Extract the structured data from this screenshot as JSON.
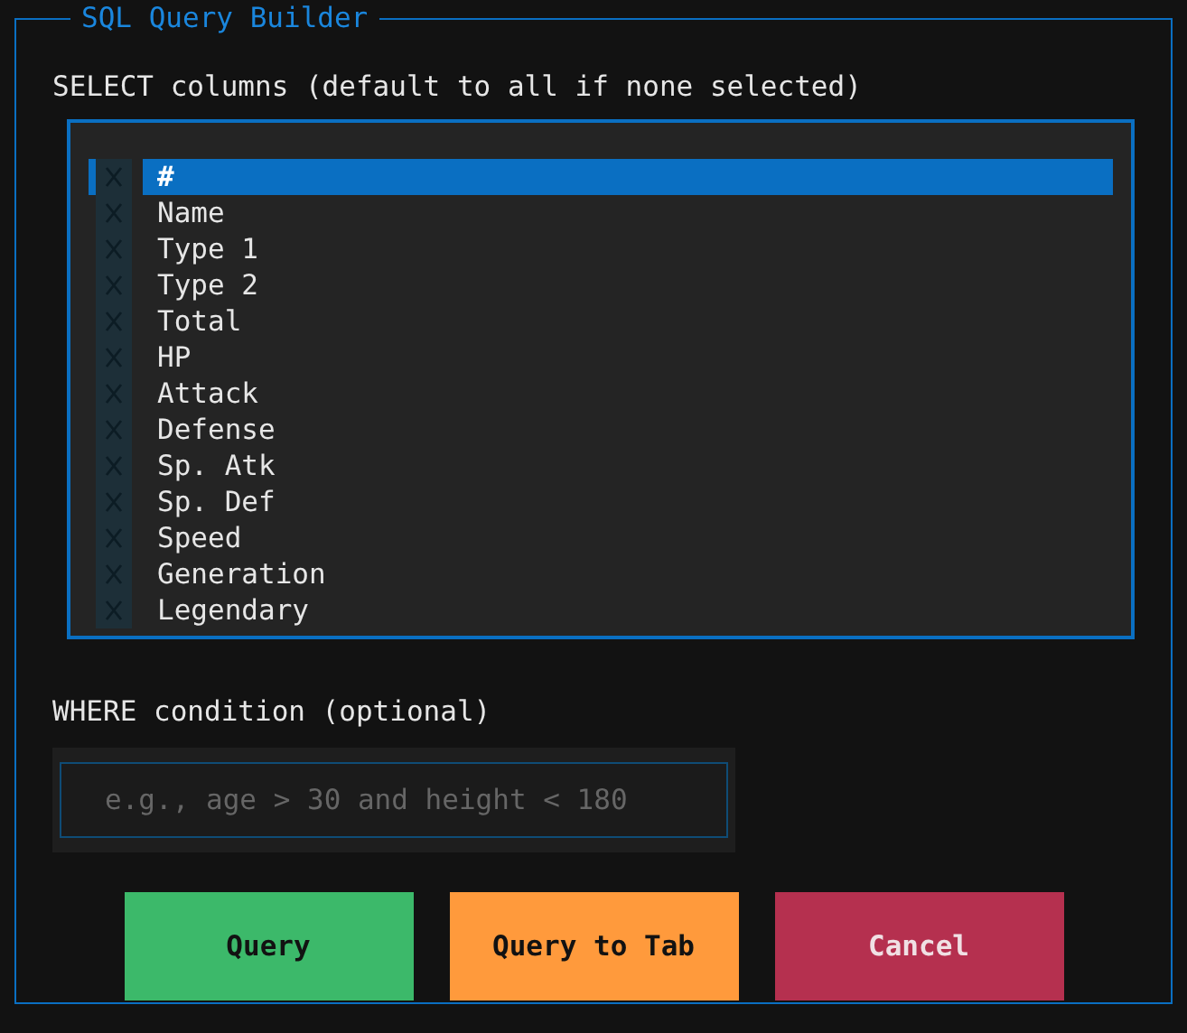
{
  "panel": {
    "title": "SQL Query Builder"
  },
  "select": {
    "label": "SELECT columns (default to all if none selected)",
    "items": [
      {
        "label": "#",
        "checked": false,
        "selected": true
      },
      {
        "label": "Name",
        "checked": false,
        "selected": false
      },
      {
        "label": "Type 1",
        "checked": false,
        "selected": false
      },
      {
        "label": "Type 2",
        "checked": false,
        "selected": false
      },
      {
        "label": "Total",
        "checked": false,
        "selected": false
      },
      {
        "label": "HP",
        "checked": false,
        "selected": false
      },
      {
        "label": "Attack",
        "checked": false,
        "selected": false
      },
      {
        "label": "Defense",
        "checked": false,
        "selected": false
      },
      {
        "label": "Sp. Atk",
        "checked": false,
        "selected": false
      },
      {
        "label": "Sp. Def",
        "checked": false,
        "selected": false
      },
      {
        "label": "Speed",
        "checked": false,
        "selected": false
      },
      {
        "label": "Generation",
        "checked": false,
        "selected": false
      },
      {
        "label": "Legendary",
        "checked": false,
        "selected": false
      }
    ]
  },
  "where": {
    "label": "WHERE condition (optional)",
    "placeholder": "e.g., age > 30 and height < 180"
  },
  "buttons": [
    {
      "label": "Query",
      "kind": "success"
    },
    {
      "label": "Query to Tab",
      "kind": "warning"
    },
    {
      "label": "Cancel",
      "kind": "error"
    }
  ]
}
